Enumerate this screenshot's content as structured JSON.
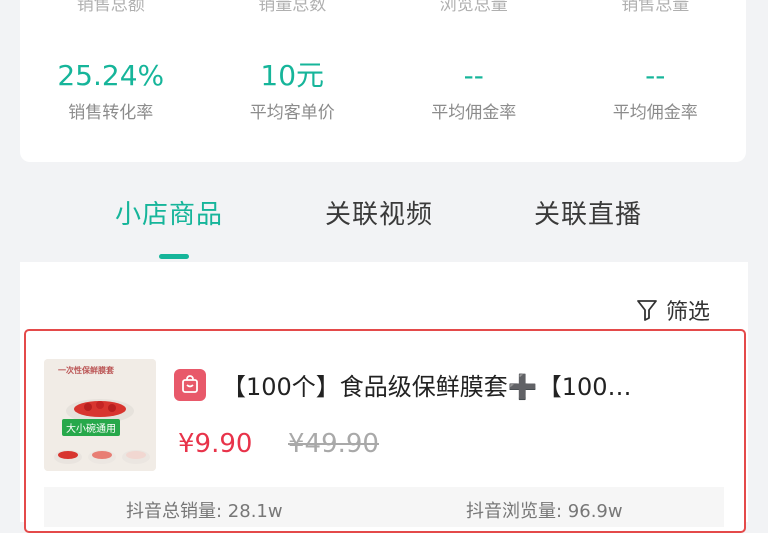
{
  "stats": {
    "top_row": [
      {
        "label": "销售总额"
      },
      {
        "label": "销量总数"
      },
      {
        "label": "浏览总量"
      },
      {
        "label": "销售总量"
      }
    ],
    "main_row": [
      {
        "value": "25.24%",
        "label": "销售转化率"
      },
      {
        "value": "10元",
        "label": "平均客单价"
      },
      {
        "value": "--",
        "label": "平均佣金率"
      },
      {
        "value": "--",
        "label": "平均佣金率"
      }
    ]
  },
  "tabs": [
    {
      "label": "小店商品",
      "active": true
    },
    {
      "label": "关联视频",
      "active": false
    },
    {
      "label": "关联直播",
      "active": false
    }
  ],
  "filter": {
    "label": "筛选",
    "icon": "filter-icon"
  },
  "product": {
    "title": "【100个】食品级保鲜膜套➕【100…",
    "price": "¥9.90",
    "original_price": "¥49.90",
    "thumb_banner": "一次性保鲜膜套",
    "thumb_tag": "大小碗通用",
    "shop_icon": "shop-bag-icon",
    "bottom_left": "抖音总销量: 28.1w",
    "bottom_right": "抖音浏览量: 96.9w"
  },
  "colors": {
    "accent": "#16b59a",
    "price": "#e8334a",
    "border": "#e44a4a"
  }
}
